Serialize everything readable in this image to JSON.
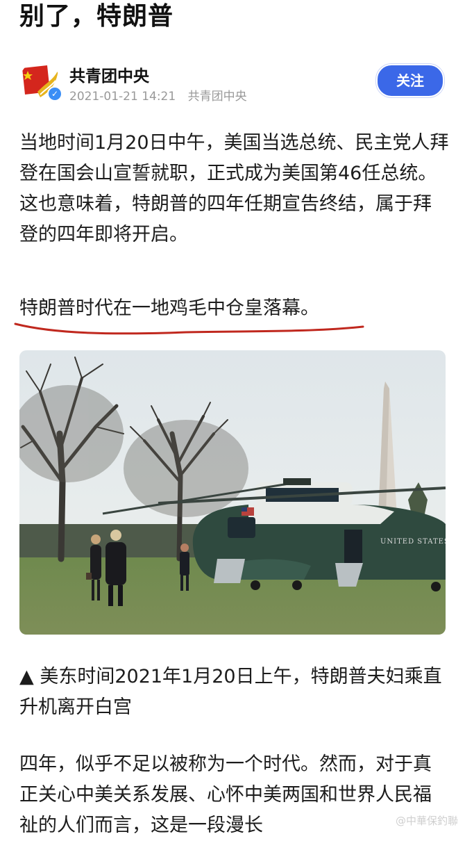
{
  "article": {
    "title": "别了，特朗普",
    "paragraph_1": "当地时间1月20日中午，美国当选总统、民主党人拜登在国会山宣誓就职，正式成为美国第46任总统。这也意味着，特朗普的四年任期宣告终结，属于拜登的四年即将开启。",
    "paragraph_2": "特朗普时代在一地鸡毛中仓皇落幕。",
    "photo_caption": "▲ 美东时间2021年1月20日上午，特朗普夫妇乘直升机离开白宫",
    "paragraph_3": "四年，似乎不足以被称为一个时代。然而，对于真正关心中美关系发展、心怀中美两国和世界人民福祉的人们而言，这是一段漫长"
  },
  "author": {
    "name": "共青团中央",
    "timestamp": "2021-01-21 14:21",
    "source": "共青团中央",
    "follow_label": "关注",
    "verified_icon": "verified-check-icon"
  },
  "photo": {
    "helicopter_text": "UNITED STATES"
  },
  "annotation": {
    "underline_color": "#c0281e"
  },
  "watermark": "@中華保釣聯"
}
